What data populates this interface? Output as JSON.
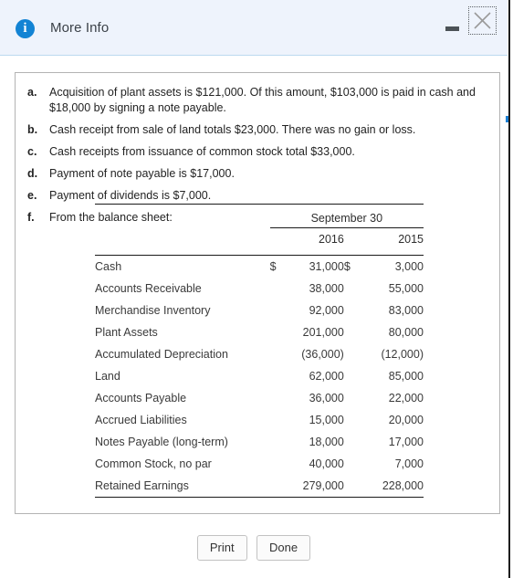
{
  "window": {
    "title": "More Info",
    "info_icon": "info-circle-icon",
    "minimize_label": "–",
    "close_label": "×",
    "accent_color": "#1283d4",
    "titlebar_color": "#eef3fc"
  },
  "facts": [
    {
      "letter": "a.",
      "text": "Acquisition of plant assets is $121,000. Of this amount, $103,000 is paid in cash and $18,000 by signing a note payable."
    },
    {
      "letter": "b.",
      "text": "Cash receipt from sale of land totals $23,000. There was no gain or loss."
    },
    {
      "letter": "c.",
      "text": "Cash receipts from issuance of common stock total $33,000."
    },
    {
      "letter": "d.",
      "text": "Payment of note payable is $17,000."
    },
    {
      "letter": "e.",
      "text": "Payment of dividends is $7,000."
    },
    {
      "letter": "f.",
      "text": "From the balance sheet:"
    }
  ],
  "balance_sheet": {
    "group_header": "September 30",
    "columns": [
      "2016",
      "2015"
    ],
    "rows": [
      {
        "label": "Cash",
        "currency_2016": "$",
        "value_2016": "31,000",
        "currency_2015": "$",
        "value_2015": "3,000"
      },
      {
        "label": "Accounts Receivable",
        "currency_2016": "",
        "value_2016": "38,000",
        "currency_2015": "",
        "value_2015": "55,000"
      },
      {
        "label": "Merchandise Inventory",
        "currency_2016": "",
        "value_2016": "92,000",
        "currency_2015": "",
        "value_2015": "83,000"
      },
      {
        "label": "Plant Assets",
        "currency_2016": "",
        "value_2016": "201,000",
        "currency_2015": "",
        "value_2015": "80,000"
      },
      {
        "label": "Accumulated Depreciation",
        "currency_2016": "",
        "value_2016": "(36,000)",
        "currency_2015": "",
        "value_2015": "(12,000)"
      },
      {
        "label": "Land",
        "currency_2016": "",
        "value_2016": "62,000",
        "currency_2015": "",
        "value_2015": "85,000"
      },
      {
        "label": "Accounts Payable",
        "currency_2016": "",
        "value_2016": "36,000",
        "currency_2015": "",
        "value_2015": "22,000"
      },
      {
        "label": "Accrued Liabilities",
        "currency_2016": "",
        "value_2016": "15,000",
        "currency_2015": "",
        "value_2015": "20,000"
      },
      {
        "label": "Notes Payable (long-term)",
        "currency_2016": "",
        "value_2016": "18,000",
        "currency_2015": "",
        "value_2015": "17,000"
      },
      {
        "label": "Common Stock, no par",
        "currency_2016": "",
        "value_2016": "40,000",
        "currency_2015": "",
        "value_2015": "7,000"
      },
      {
        "label": "Retained Earnings",
        "currency_2016": "",
        "value_2016": "279,000",
        "currency_2015": "",
        "value_2015": "228,000"
      }
    ]
  },
  "footer": {
    "print_label": "Print",
    "done_label": "Done"
  }
}
